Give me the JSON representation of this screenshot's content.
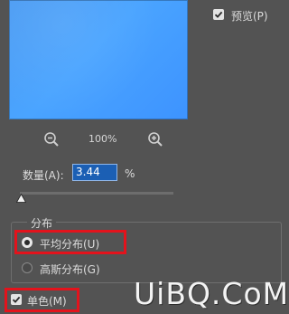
{
  "preview": {
    "checkbox_checked": true,
    "label": "预览(P)"
  },
  "zoom": {
    "level": "100%",
    "zoom_out_icon": "zoom-out-icon",
    "zoom_in_icon": "zoom-in-icon"
  },
  "amount": {
    "label": "数量(A):",
    "value": "3.44",
    "unit": "%",
    "slider_fraction": 0.0
  },
  "distribution": {
    "title": "分布",
    "options": [
      {
        "label": "平均分布(U)",
        "selected": true
      },
      {
        "label": "高斯分布(G)",
        "selected": false
      }
    ]
  },
  "monochromatic": {
    "label": "单色(M)",
    "checked": true
  },
  "watermark": {
    "text": "UiBQ.CoM"
  },
  "colors": {
    "background": "#535353",
    "preview_fill": "#4a9ff7",
    "highlight": "#e3131c",
    "input_bg": "#1b5fb4"
  }
}
